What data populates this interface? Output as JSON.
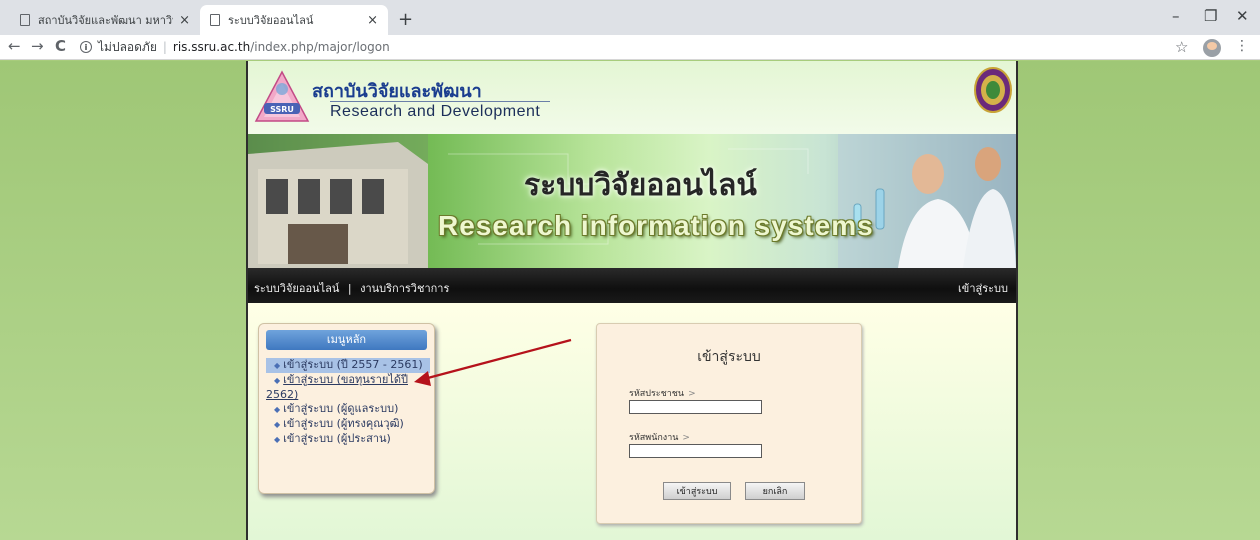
{
  "browser": {
    "tabs": [
      {
        "title": "สถาบันวิจัยและพัฒนา มหาวิทยาลัยราช",
        "active": false
      },
      {
        "title": "ระบบวิจัยออนไลน์",
        "active": true
      }
    ],
    "new_tab": "+",
    "tab_close": "×",
    "window_controls": {
      "minimize": "–",
      "maximize": "❐",
      "close": "✕"
    },
    "nav": {
      "back": "←",
      "forward": "→",
      "reload": "C"
    },
    "address": {
      "security_icon": "ⓘ",
      "security_label": "ไม่ปลอดภัย",
      "separator": "|",
      "host": "ris.ssru.ac.th",
      "path": "/index.php/major/logon"
    },
    "star": "☆",
    "menu": "⋮"
  },
  "header": {
    "title_th": "สถาบันวิจัยและพัฒนา",
    "title_en": "Research and Development",
    "logo_text": "SSRU"
  },
  "banner": {
    "title_th": "ระบบวิจัยออนไลน์",
    "title_en": "Research information systems"
  },
  "navbar": {
    "left_items": [
      "ระบบวิจัยออนไลน์",
      "งานบริการวิชาการ"
    ],
    "separator": "|",
    "right_item": "เข้าสู่ระบบ"
  },
  "menu": {
    "title": "เมนูหลัก",
    "bullet": "◆",
    "items": [
      {
        "label": "เข้าสู่ระบบ (ปี 2557 - 2561)",
        "selected": true
      },
      {
        "label": "เข้าสู่ระบบ (ขอทุนรายได้ปี 2562)",
        "selected": false
      },
      {
        "label": "เข้าสู่ระบบ (ผู้ดูแลระบบ)",
        "selected": false
      },
      {
        "label": "เข้าสู่ระบบ (ผู้ทรงคุณวุฒิ)",
        "selected": false
      },
      {
        "label": "เข้าสู่ระบบ (ผู้ประสาน)",
        "selected": false
      }
    ]
  },
  "login": {
    "title": "เข้าสู่ระบบ",
    "id_label": "รหัสประชาชน",
    "id_value": "",
    "emp_label": "รหัสพนักงาน",
    "emp_value": "",
    "chevron": ">",
    "submit": "เข้าสู่ระบบ",
    "cancel": "ยกเลิก"
  },
  "colors": {
    "page_bg": "#a8cc7c",
    "menu_title_bg": "#4f86cc",
    "arrow": "#b5121b",
    "navbar": "#1a1a1a"
  }
}
